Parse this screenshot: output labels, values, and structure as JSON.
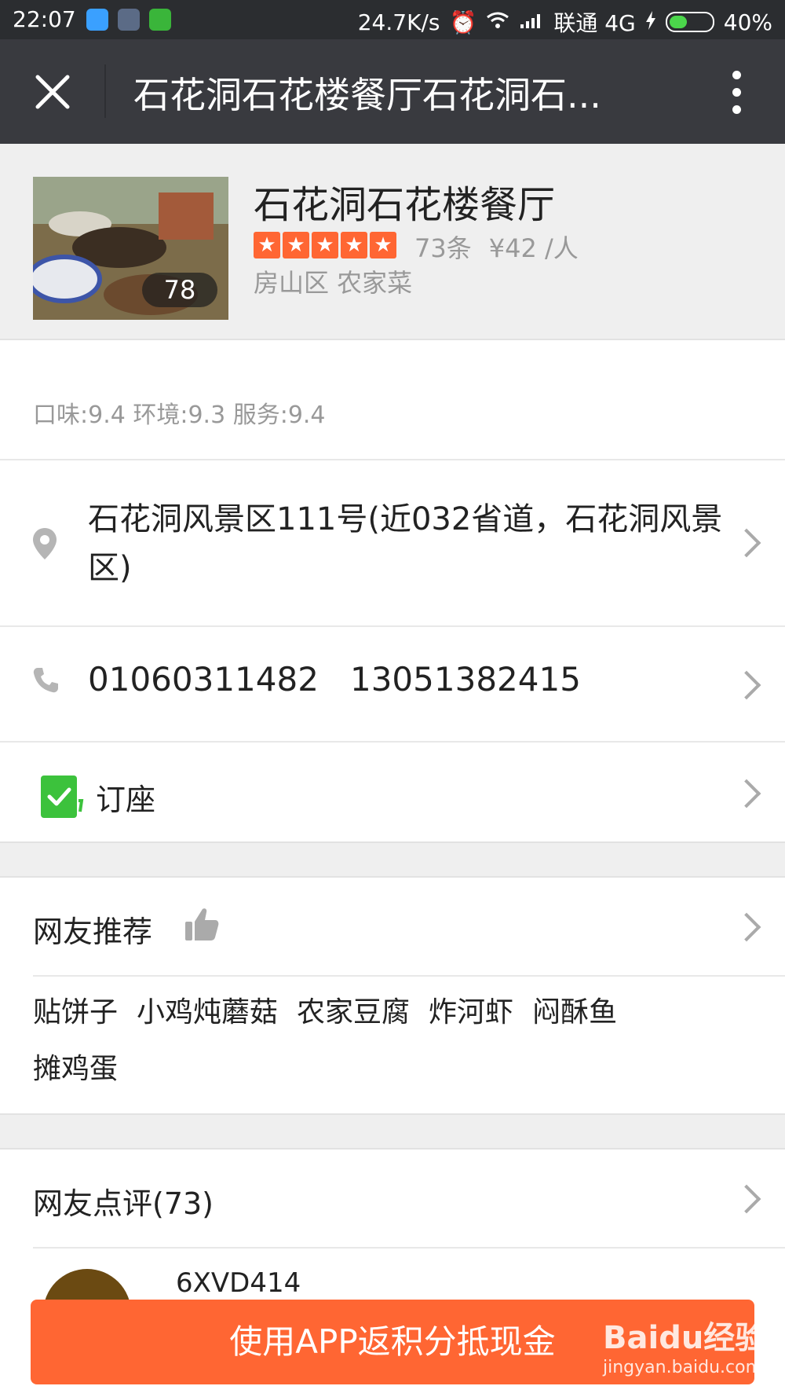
{
  "status_bar": {
    "time": "22:07",
    "net_speed": "24.7K/s",
    "carrier": "联通 4G",
    "battery": "40%",
    "battery_level": 0.4,
    "icons": [
      "browser-app-icon",
      "scissors-app-icon",
      "cat-app-icon",
      "alarm-icon",
      "wifi-icon",
      "signal-icon",
      "charging-icon",
      "battery-icon"
    ]
  },
  "title_bar": {
    "title": "石花洞石花楼餐厅石花洞石...",
    "icons": [
      "close-icon",
      "more-icon"
    ]
  },
  "shop": {
    "photo_count": "78",
    "name": "石花洞石花楼餐厅",
    "rating": 5,
    "star_glyph": "★",
    "review_count": "73条",
    "avg_price": "¥42 /人",
    "district": "房山区 农家菜",
    "scores": "口味:9.4 环境:9.3 服务:9.4"
  },
  "address": {
    "text": "石花洞风景区111号(近032省道，石花洞风景区)",
    "icon": "location-pin-icon"
  },
  "phone": {
    "text": "01060311482   13051382415",
    "icon": "phone-icon"
  },
  "reserve": {
    "label": "订座",
    "icon": "check-icon"
  },
  "recommend": {
    "title": "网友推荐",
    "icon": "thumbs-up-icon",
    "dishes": [
      "贴饼子",
      "小鸡炖蘑菇",
      "农家豆腐",
      "炸河虾",
      "闷酥鱼",
      "摊鸡蛋"
    ]
  },
  "reviews": {
    "title": "网友点评(73)",
    "first_user": "6XVD414"
  },
  "cta": {
    "label": "使用APP返积分抵现金"
  },
  "watermark": {
    "brand": "Baidu经验",
    "url": "jingyan.baidu.com"
  },
  "colors": {
    "accent": "#ff6633",
    "title_bar": "#393a3f",
    "status_bar": "#2b2d30",
    "check_green": "#3cc23c"
  }
}
